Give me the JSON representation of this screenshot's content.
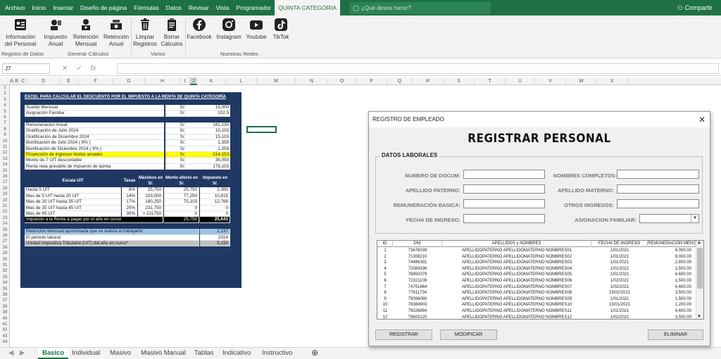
{
  "menu": {
    "tabs": [
      "Archivo",
      "Inicio",
      "Insertar",
      "Diseño de página",
      "Fórmulas",
      "Datos",
      "Revisar",
      "Vista",
      "Programador",
      "QUINTA CATEGORIA"
    ],
    "tell_me": "¿Qué desea hacer?",
    "share": "Compartir"
  },
  "ribbon": {
    "buttons": [
      {
        "label": "Información del Personal",
        "icon": "personnel-card-icon"
      },
      {
        "label": "Impuesto Anual",
        "icon": "annual-tax-icon"
      },
      {
        "label": "Retención Mensual",
        "icon": "monthly-retention-icon"
      },
      {
        "label": "Retención Anual",
        "icon": "annual-retention-icon"
      },
      {
        "label": "Limpiar Registros",
        "icon": "trash-icon"
      },
      {
        "label": "Borrar Cálculos",
        "icon": "clipboard-delete-icon"
      },
      {
        "label": "Facebook",
        "icon": "facebook-icon"
      },
      {
        "label": "Instagram",
        "icon": "instagram-icon"
      },
      {
        "label": "Youtube",
        "icon": "youtube-icon"
      },
      {
        "label": "TikTok",
        "icon": "tiktok-icon"
      }
    ],
    "groups": [
      "Registro de Datos",
      "Generar Cálculos",
      "Varios",
      "Nuestras Redes"
    ]
  },
  "formula_bar": {
    "name_box": "J7",
    "cancel": "✕",
    "enter": "✓",
    "fx": "fx",
    "content": ""
  },
  "columns": [
    "A",
    "B",
    "C",
    "D",
    "E",
    "F",
    "G",
    "H",
    "I",
    "J",
    "K",
    "L",
    "M",
    "N",
    "O",
    "P",
    "Q",
    "R",
    "S",
    "T",
    "U",
    "V",
    "W",
    "X"
  ],
  "rows": [
    "1",
    "2",
    "3",
    "4",
    "5",
    "6",
    "7",
    "8",
    "9",
    "10",
    "11",
    "12",
    "13",
    "14",
    "15",
    "16",
    "17",
    "18",
    "19",
    "20",
    "21",
    "22",
    "23",
    "24",
    "25",
    "26",
    "27",
    "28",
    "29",
    "30",
    "31",
    "32",
    "33",
    "34",
    "35",
    "36",
    "37",
    "38",
    "39",
    "40",
    "41",
    "42",
    "43",
    "44"
  ],
  "calc": {
    "title": "EXCEL PARA CALCULAR EL DESCUENTO POR EL IMPUESTO A LA RENTA DE QUINTA CATEGORÍA",
    "sueldo": [
      {
        "label": "Sueldo Mensual",
        "cur": "S/.",
        "amt": "15,000"
      },
      {
        "label": "Asignación Familiar",
        "cur": "S/.",
        "amt": "102.5"
      }
    ],
    "ingresos": [
      {
        "label": "Remuneracion Anual",
        "cur": "S/.",
        "amt": "181,230"
      },
      {
        "label": "Gratificación de Julio 2024",
        "cur": "S/.",
        "amt": "15,103"
      },
      {
        "label": "Gratificación de Diciembre 2024",
        "cur": "S/.",
        "amt": "15,103"
      },
      {
        "label": "Bonificación de Julio 2024 ( 9% )",
        "cur": "S/.",
        "amt": "1,359"
      },
      {
        "label": "Bonificación de Diciembre 2024 ( 9% )",
        "cur": "S/.",
        "amt": "1,359"
      },
      {
        "label": "Proyección de ingresos brutos anuales",
        "cur": "S/.",
        "amt": "214,153"
      },
      {
        "label": "Monto de 7 UIT descontable",
        "cur": "S/.",
        "amt": "36,050"
      },
      {
        "label": "Renta neta gravable de impuesto de quinta",
        "cur": "S/.",
        "amt": "178,103"
      }
    ],
    "uit_headers": [
      "Escala UIT",
      "Tasas",
      "Máximos en S/.",
      "Monto afecto en S/.",
      "Impuesto en S/."
    ],
    "uit_rows": [
      [
        "Hasta 5 UIT",
        "8%",
        "25,750",
        "25,750",
        "2,060"
      ],
      [
        "Mas de 5 UIT hasta 20 UIT",
        "14%",
        "103,000",
        "77,250",
        "10,815"
      ],
      [
        "Mas de 20 UIT hasta 35 UIT",
        "17%",
        "180,250",
        "75,103",
        "12,768"
      ],
      [
        "Mas de 35 UIT hasta 45 UIT",
        "20%",
        "231,750",
        "0",
        "0"
      ],
      [
        "Mas de 45 UIT",
        "30%",
        "> 231750",
        "0",
        "0"
      ]
    ],
    "total": {
      "label": "Impuesto a la Renta a pagar por el año en curso",
      "afecto": "25,750",
      "impuesto": "25,643"
    },
    "footer": [
      {
        "label": "Retención Mensual aproximada que se realiza al trabajador",
        "amt": "2,137"
      },
      {
        "label": "El periodo laboral",
        "amt": "2024"
      },
      {
        "label": "Unidad Impositiva Tributaria (UIT) del año en curso*",
        "amt": "5,150"
      }
    ]
  },
  "sheet_tabs": [
    "Basico",
    "Individual",
    "Masivo",
    "Masivo Manual",
    "Tablas",
    "Indicativo",
    "Instructivo"
  ],
  "dialog": {
    "title": "REGISTRO DE EMPLEADO",
    "close": "✕",
    "heading": "REGISTRAR PERSONAL",
    "frame_label": "DATOS LABORALES",
    "fields": {
      "numero_docum": {
        "label": "NUMERO DE DOCUM:",
        "value": ""
      },
      "nombres": {
        "label": "NOMBRES COMPLETOS:",
        "value": ""
      },
      "apellido_paterno": {
        "label": "APELLIDO PATERNO:",
        "value": ""
      },
      "apellido_materno": {
        "label": "APELLIDO MATERNO:",
        "value": ""
      },
      "remuneracion": {
        "label": "REMUNERACIÓN BASICA:",
        "value": ""
      },
      "otros_ingresos": {
        "label": "OTROS INGRESOS:",
        "value": ""
      },
      "fecha_ingreso": {
        "label": "FECHA DE INGRESO:",
        "value": ""
      },
      "asignacion": {
        "label": "ASIGNACION FAMILIAR:",
        "value": ""
      }
    },
    "list_headers": [
      "ID",
      "DNI",
      "APELLIDOS y NOMBRES",
      "FECHA DE INGRESO",
      "REMUNERACIÓN MENSUA"
    ],
    "list_rows": [
      [
        "1",
        "73676039",
        "APELLIDOPATERNO APELLIDOMATERNO NOMBRES01",
        "1/01/2021",
        "4,000.00"
      ],
      [
        "2",
        "71308210",
        "APELLIDOPATERNO APELLIDOMATERNO NOMBRES02",
        "1/01/2021",
        "9,000.00"
      ],
      [
        "3",
        "74486301",
        "APELLIDOPATERNO APELLIDOMATERNO NOMBRES03",
        "1/01/2021",
        "2,800.00"
      ],
      [
        "4",
        "72084336",
        "APELLIDOPATERNO APELLIDOMATERNO NOMBRES04",
        "1/01/2021",
        "1,500.00"
      ],
      [
        "5",
        "76850379",
        "APELLIDOPATERNO APELLIDOMATERNO NOMBRES05",
        "1/01/2021",
        "4,600.00"
      ],
      [
        "6",
        "72321109",
        "APELLIDOPATERNO APELLIDOMATERNO NOMBRES06",
        "1/02/2021",
        "1,500.00"
      ],
      [
        "7",
        "74751664",
        "APELLIDOPATERNO APELLIDOMATERNO NOMBRES07",
        "1/02/2021",
        "4,600.00"
      ],
      [
        "8",
        "77611734",
        "APELLIDOPATERNO APELLIDOMATERNO NOMBRES08",
        "15/02/2021",
        "3,500.00"
      ],
      [
        "9",
        "79096080",
        "APELLIDOPATERNO APELLIDOMATERNO NOMBRES09",
        "1/01/2021",
        "1,500.00"
      ],
      [
        "10",
        "76384903",
        "APELLIDOPATERNO APELLIDOMATERNO NOMBRES10",
        "15/01/2021",
        "1,200.00"
      ],
      [
        "11",
        "79226894",
        "APELLIDOPATERNO APELLIDOMATERNO NOMBRES11",
        "1/01/2021",
        "4,600.00"
      ],
      [
        "12",
        "79603125",
        "APELLIDOPATERNO APELLIDOMATERNO NOMBRES12",
        "1/02/2021",
        "3,500.00"
      ]
    ],
    "buttons": {
      "registrar": "REGISTRAR",
      "modificar": "MODIFICAR",
      "eliminar": "ELIMINAR"
    }
  },
  "colors": {
    "excel_green": "#1e7145",
    "navy": "#1f3864",
    "highlight": "#ffff00",
    "light_blue": "#9dc3e6"
  }
}
